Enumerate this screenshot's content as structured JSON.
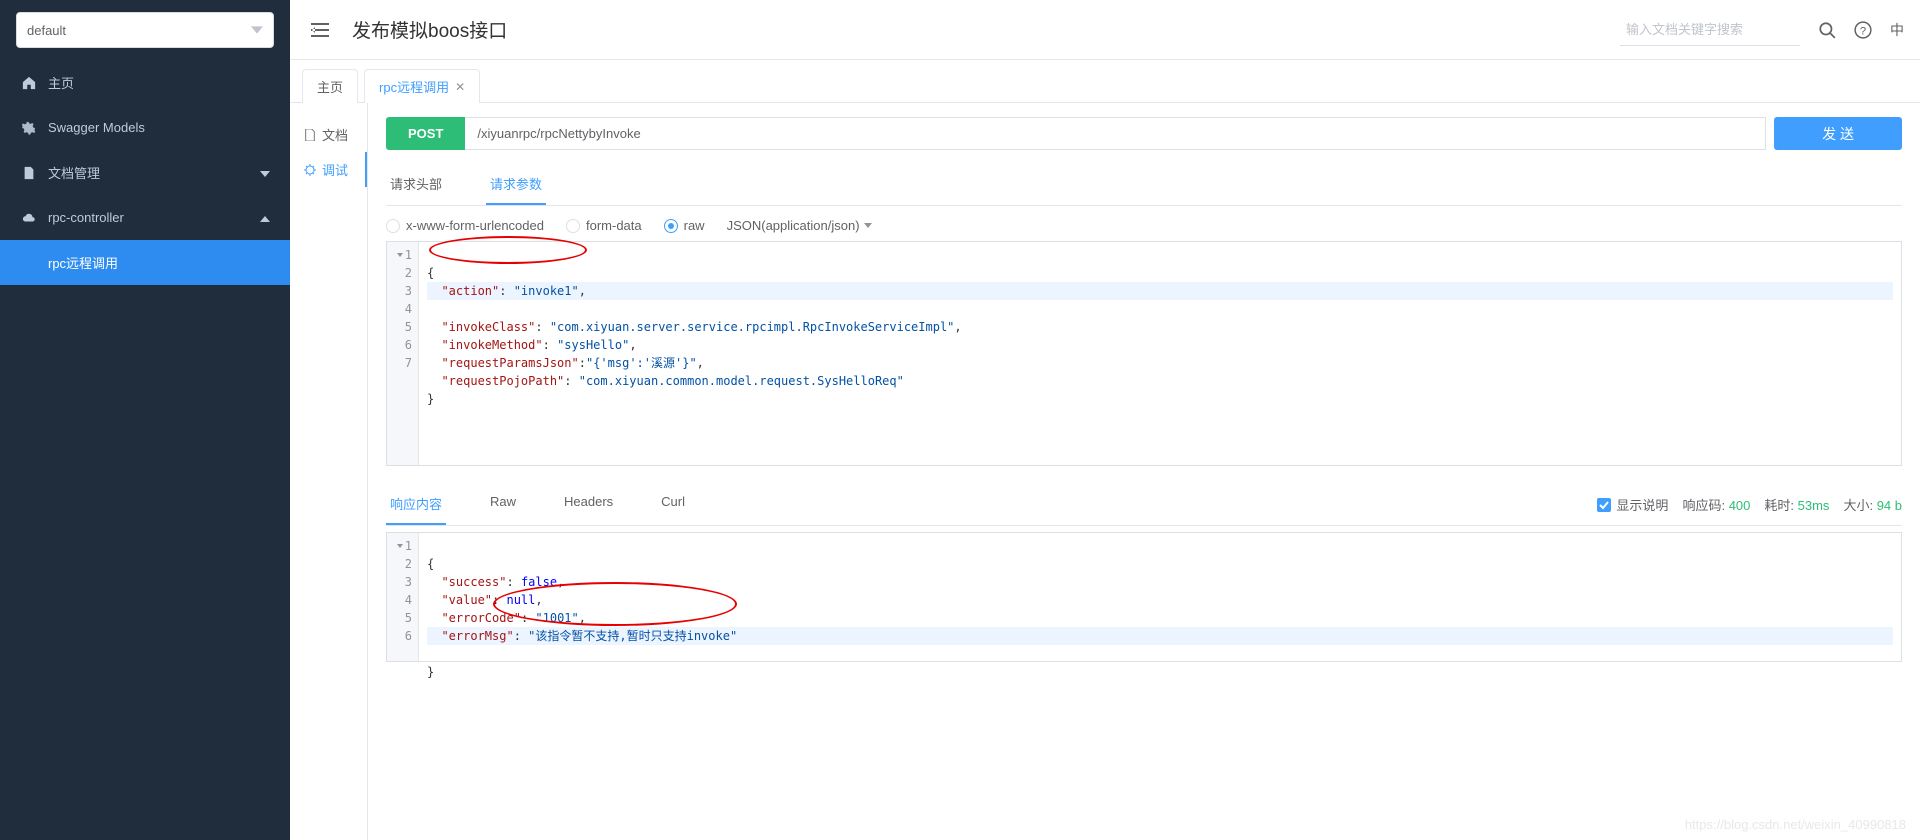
{
  "sidebar": {
    "selector": {
      "value": "default"
    },
    "items": [
      {
        "label": "主页",
        "icon": "home"
      },
      {
        "label": "Swagger Models",
        "icon": "cog"
      },
      {
        "label": "文档管理",
        "icon": "doc",
        "hasChildren": true
      },
      {
        "label": "rpc-controller",
        "icon": "cloud",
        "expanded": true,
        "children": [
          {
            "label": "rpc远程调用",
            "active": true
          }
        ]
      }
    ]
  },
  "header": {
    "title": "发布模拟boos接口",
    "search_placeholder": "输入文档关键字搜索",
    "lang": "中"
  },
  "tabs": [
    {
      "label": "主页",
      "closable": false
    },
    {
      "label": "rpc远程调用",
      "closable": true,
      "active": true
    }
  ],
  "inspector": [
    {
      "label": "文档",
      "icon": "file"
    },
    {
      "label": "调试",
      "icon": "bug",
      "active": true
    }
  ],
  "debug": {
    "method": "POST",
    "url": "/xiyuanrpc/rpcNettybyInvoke",
    "send_label": "发 送",
    "req_tabs": [
      {
        "label": "请求头部"
      },
      {
        "label": "请求参数",
        "active": true
      }
    ],
    "body_types": {
      "urlencoded": "x-www-form-urlencoded",
      "formdata": "form-data",
      "raw": "raw",
      "selected": "raw",
      "content_type": "JSON(application/json)"
    },
    "request_body": {
      "action": "invoke1",
      "invokeClass": "com.xiyuan.server.service.rpcimpl.RpcInvokeServiceImpl",
      "invokeMethod": "sysHello",
      "requestParamsJson": "{'msg':'溪源'}",
      "requestPojoPath": "com.xiyuan.common.model.request.SysHelloReq"
    },
    "resp_tabs": [
      {
        "label": "响应内容",
        "active": true
      },
      {
        "label": "Raw"
      },
      {
        "label": "Headers"
      },
      {
        "label": "Curl"
      }
    ],
    "resp_meta": {
      "show_desc_label": "显示说明",
      "code_label": "响应码:",
      "code_value": "400",
      "time_label": "耗时:",
      "time_value": "53ms",
      "size_label": "大小:",
      "size_value": "94 b"
    },
    "response_body": {
      "success": false,
      "value": null,
      "errorCode": "1001",
      "errorMsg": "该指令暂不支持,暂时只支持invoke"
    }
  },
  "watermark": "https://blog.csdn.net/weixin_40990818"
}
